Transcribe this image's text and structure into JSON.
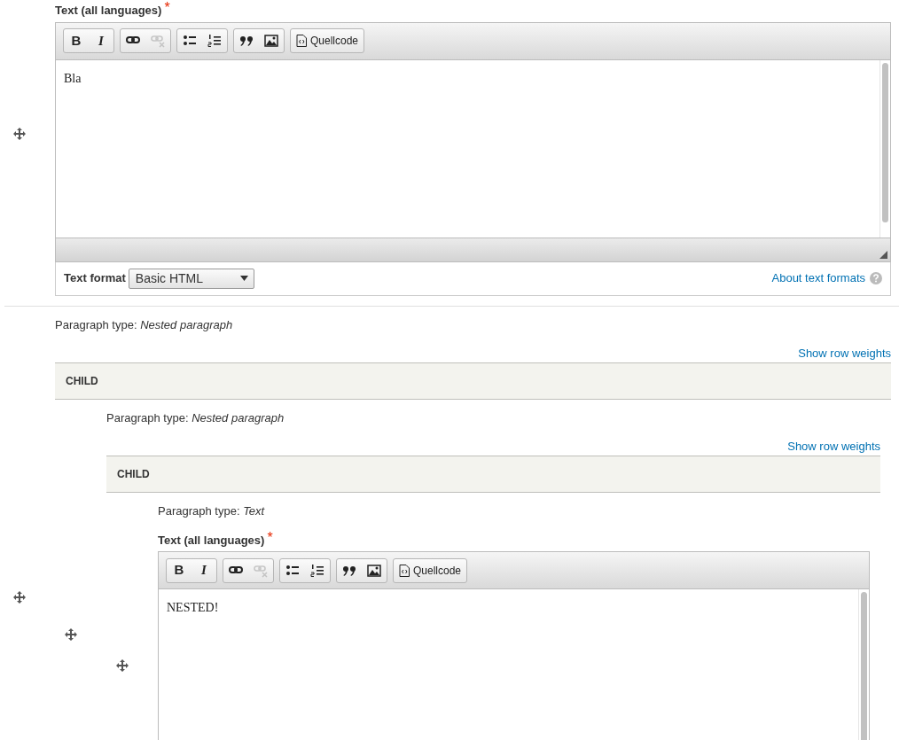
{
  "editor": {
    "label": "Text (all languages)",
    "required": true,
    "required_mark": "*",
    "toolbar": [
      [
        {
          "kind": "bold",
          "label": "B",
          "disabled": false
        },
        {
          "kind": "italic",
          "label": "I",
          "disabled": false
        }
      ],
      [
        {
          "kind": "link",
          "disabled": false
        },
        {
          "kind": "unlink",
          "disabled": true
        }
      ],
      [
        {
          "kind": "bullet-list",
          "disabled": false
        },
        {
          "kind": "numbered-list",
          "disabled": false
        }
      ],
      [
        {
          "kind": "blockquote",
          "disabled": false
        },
        {
          "kind": "image",
          "disabled": false
        }
      ],
      [
        {
          "kind": "source",
          "label": "Quellcode",
          "disabled": false
        }
      ]
    ],
    "content": "Bla",
    "text_format": {
      "label": "Text format",
      "value": "Basic HTML"
    },
    "help_link": "About text formats"
  },
  "paragraph": {
    "type_label": "Paragraph type:",
    "type": "Nested paragraph",
    "show_row_weights": "Show row weights",
    "header": "CHILD",
    "child": {
      "type_label": "Paragraph type:",
      "type": "Nested paragraph",
      "show_row_weights": "Show row weights",
      "header": "CHILD",
      "child": {
        "type_label": "Paragraph type:",
        "type": "Text",
        "editor": {
          "label": "Text (all languages)",
          "required": true,
          "required_mark": "*",
          "toolbar": [
            [
              {
                "kind": "bold",
                "label": "B",
                "disabled": false
              },
              {
                "kind": "italic",
                "label": "I",
                "disabled": false
              }
            ],
            [
              {
                "kind": "link",
                "disabled": false
              },
              {
                "kind": "unlink",
                "disabled": true
              }
            ],
            [
              {
                "kind": "bullet-list",
                "disabled": false
              },
              {
                "kind": "numbered-list",
                "disabled": false
              }
            ],
            [
              {
                "kind": "blockquote",
                "disabled": false
              },
              {
                "kind": "image",
                "disabled": false
              }
            ],
            [
              {
                "kind": "source",
                "label": "Quellcode",
                "disabled": false
              }
            ]
          ],
          "content": "NESTED!"
        }
      }
    }
  }
}
